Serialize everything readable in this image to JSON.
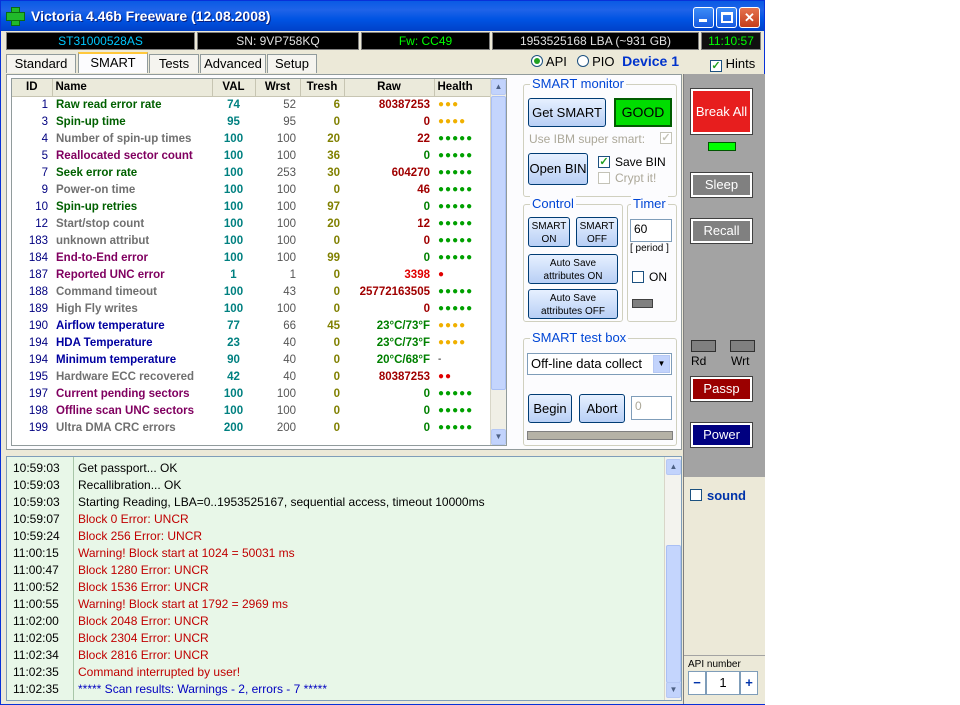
{
  "window": {
    "title": "Victoria 4.46b Freeware (12.08.2008)",
    "min_glyph": "_",
    "max_glyph": "□",
    "close_glyph": "✕"
  },
  "info_bar": {
    "model": "ST31000528AS",
    "serial": "SN: 9VP758KQ",
    "firmware": "Fw: CC49",
    "lba": "1953525168 LBA (~931 GB)",
    "time": "11:10:57"
  },
  "tabs": [
    "Standard",
    "SMART",
    "Tests",
    "Advanced",
    "Setup"
  ],
  "active_tab": "SMART",
  "api": {
    "api_label": "API",
    "pio_label": "PIO",
    "device_label": "Device 1",
    "hints_label": "Hints",
    "api_selected": true,
    "hints_checked": true
  },
  "smart_table": {
    "headers": [
      "ID",
      "Name",
      "VAL",
      "Wrst",
      "Tresh",
      "Raw",
      "Health"
    ],
    "rows": [
      {
        "id": "1",
        "name": "Raw read error rate",
        "val": "74",
        "wrst": "52",
        "tresh": "6",
        "raw": "80387253",
        "health": "●●●",
        "name_color": "#006000",
        "raw_color": "#a00000",
        "health_color": "#f0b000"
      },
      {
        "id": "3",
        "name": "Spin-up time",
        "val": "95",
        "wrst": "95",
        "tresh": "0",
        "raw": "0",
        "health": "●●●●",
        "name_color": "#006000",
        "raw_color": "#a00000",
        "health_color": "#f0b000"
      },
      {
        "id": "4",
        "name": "Number of spin-up times",
        "val": "100",
        "wrst": "100",
        "tresh": "20",
        "raw": "22",
        "health": "●●●●●",
        "name_color": "#707070",
        "raw_color": "#a00000",
        "health_color": "#00a000"
      },
      {
        "id": "5",
        "name": "Reallocated sector count",
        "val": "100",
        "wrst": "100",
        "tresh": "36",
        "raw": "0",
        "health": "●●●●●",
        "name_color": "#800060",
        "raw_color": "#008000",
        "health_color": "#00a000"
      },
      {
        "id": "7",
        "name": "Seek error rate",
        "val": "100",
        "wrst": "253",
        "tresh": "30",
        "raw": "604270",
        "health": "●●●●●",
        "name_color": "#006000",
        "raw_color": "#a00000",
        "health_color": "#00a000"
      },
      {
        "id": "9",
        "name": "Power-on time",
        "val": "100",
        "wrst": "100",
        "tresh": "0",
        "raw": "46",
        "health": "●●●●●",
        "name_color": "#707070",
        "raw_color": "#a00000",
        "health_color": "#00a000"
      },
      {
        "id": "10",
        "name": "Spin-up retries",
        "val": "100",
        "wrst": "100",
        "tresh": "97",
        "raw": "0",
        "health": "●●●●●",
        "name_color": "#006000",
        "raw_color": "#008000",
        "health_color": "#00a000"
      },
      {
        "id": "12",
        "name": "Start/stop count",
        "val": "100",
        "wrst": "100",
        "tresh": "20",
        "raw": "12",
        "health": "●●●●●",
        "name_color": "#707070",
        "raw_color": "#a00000",
        "health_color": "#00a000"
      },
      {
        "id": "183",
        "name": "unknown attribut",
        "val": "100",
        "wrst": "100",
        "tresh": "0",
        "raw": "0",
        "health": "●●●●●",
        "name_color": "#707070",
        "raw_color": "#a00000",
        "health_color": "#00a000"
      },
      {
        "id": "184",
        "name": "End-to-End error",
        "val": "100",
        "wrst": "100",
        "tresh": "99",
        "raw": "0",
        "health": "●●●●●",
        "name_color": "#800060",
        "raw_color": "#008000",
        "health_color": "#00a000"
      },
      {
        "id": "187",
        "name": "Reported UNC error",
        "val": "1",
        "wrst": "1",
        "tresh": "0",
        "raw": "3398",
        "health": "●",
        "name_color": "#800060",
        "raw_color": "#e00000",
        "health_color": "#e00000"
      },
      {
        "id": "188",
        "name": "Command timeout",
        "val": "100",
        "wrst": "43",
        "tresh": "0",
        "raw": "25772163505",
        "health": "●●●●●",
        "name_color": "#707070",
        "raw_color": "#a00000",
        "health_color": "#00a000"
      },
      {
        "id": "189",
        "name": "High Fly writes",
        "val": "100",
        "wrst": "100",
        "tresh": "0",
        "raw": "0",
        "health": "●●●●●",
        "name_color": "#707070",
        "raw_color": "#a00000",
        "health_color": "#00a000"
      },
      {
        "id": "190",
        "name": "Airflow temperature",
        "val": "77",
        "wrst": "66",
        "tresh": "45",
        "raw": "23°C/73°F",
        "health": "●●●●",
        "name_color": "#0000a0",
        "raw_color": "#008000",
        "health_color": "#f0b000"
      },
      {
        "id": "194",
        "name": "HDA Temperature",
        "val": "23",
        "wrst": "40",
        "tresh": "0",
        "raw": "23°C/73°F",
        "health": "●●●●",
        "name_color": "#0000a0",
        "raw_color": "#008000",
        "health_color": "#f0b000"
      },
      {
        "id": "194",
        "name": "Minimum temperature",
        "val": "90",
        "wrst": "40",
        "tresh": "0",
        "raw": "20°C/68°F",
        "health": "-",
        "name_color": "#0000a0",
        "raw_color": "#008000",
        "health_color": "#000000"
      },
      {
        "id": "195",
        "name": "Hardware ECC recovered",
        "val": "42",
        "wrst": "40",
        "tresh": "0",
        "raw": "80387253",
        "health": "●●",
        "name_color": "#707070",
        "raw_color": "#a00000",
        "health_color": "#e00000"
      },
      {
        "id": "197",
        "name": "Current pending sectors",
        "val": "100",
        "wrst": "100",
        "tresh": "0",
        "raw": "0",
        "health": "●●●●●",
        "name_color": "#800060",
        "raw_color": "#008000",
        "health_color": "#00a000"
      },
      {
        "id": "198",
        "name": "Offline scan UNC sectors",
        "val": "100",
        "wrst": "100",
        "tresh": "0",
        "raw": "0",
        "health": "●●●●●",
        "name_color": "#800060",
        "raw_color": "#008000",
        "health_color": "#00a000"
      },
      {
        "id": "199",
        "name": "Ultra DMA CRC errors",
        "val": "200",
        "wrst": "200",
        "tresh": "0",
        "raw": "0",
        "health": "●●●●●",
        "name_color": "#707070",
        "raw_color": "#008000",
        "health_color": "#00a000"
      }
    ]
  },
  "smart_monitor": {
    "title": "SMART monitor",
    "get_smart": "Get SMART",
    "status": "GOOD",
    "use_ibm": "Use IBM super smart:",
    "open_bin": "Open BIN",
    "save_bin": "Save BIN",
    "crypt_it": "Crypt it!"
  },
  "control": {
    "title": "Control",
    "smart_on": "SMART ON",
    "smart_off": "SMART OFF",
    "autosave_on": "Auto Save attributes ON",
    "autosave_off": "Auto Save attributes OFF"
  },
  "timer": {
    "title": "Timer",
    "value": "60",
    "period": "[ period ]",
    "on_label": "ON"
  },
  "test_box": {
    "title": "SMART test box",
    "selected": "Off-line data collect",
    "begin": "Begin",
    "abort": "Abort",
    "input_placeholder": "0"
  },
  "log": [
    {
      "time": "10:59:03",
      "msg": "Get passport... OK",
      "color": "#000000"
    },
    {
      "time": "10:59:03",
      "msg": "Recallibration... OK",
      "color": "#000000"
    },
    {
      "time": "10:59:03",
      "msg": "Starting Reading, LBA=0..1953525167, sequential access, timeout 10000ms",
      "color": "#000000"
    },
    {
      "time": "10:59:07",
      "msg": "Block 0 Error: UNCR",
      "color": "#c00000"
    },
    {
      "time": "10:59:24",
      "msg": "Block 256 Error: UNCR",
      "color": "#c00000"
    },
    {
      "time": "11:00:15",
      "msg": "Warning! Block start at 1024 = 50031 ms",
      "color": "#c00000"
    },
    {
      "time": "11:00:47",
      "msg": "Block 1280 Error: UNCR",
      "color": "#c00000"
    },
    {
      "time": "11:00:52",
      "msg": "Block 1536 Error: UNCR",
      "color": "#c00000"
    },
    {
      "time": "11:00:55",
      "msg": "Warning! Block start at 1792 = 2969 ms",
      "color": "#c00000"
    },
    {
      "time": "11:02:00",
      "msg": "Block 2048 Error: UNCR",
      "color": "#c00000"
    },
    {
      "time": "11:02:05",
      "msg": "Block 2304 Error: UNCR",
      "color": "#c00000"
    },
    {
      "time": "11:02:34",
      "msg": "Block 2816 Error: UNCR",
      "color": "#c00000"
    },
    {
      "time": "11:02:35",
      "msg": "Command interrupted by user!",
      "color": "#c00000"
    },
    {
      "time": "11:02:35",
      "msg": "***** Scan results: Warnings - 2, errors - 7 *****",
      "color": "#0000c0"
    }
  ],
  "right_panel": {
    "break_all": "Break All",
    "sleep": "Sleep",
    "recall": "Recall",
    "rd": "Rd",
    "wrt": "Wrt",
    "passp": "Passp",
    "power": "Power",
    "sound": "sound",
    "api_number_label": "API number",
    "api_number": "1",
    "minus": "−",
    "plus": "+"
  }
}
